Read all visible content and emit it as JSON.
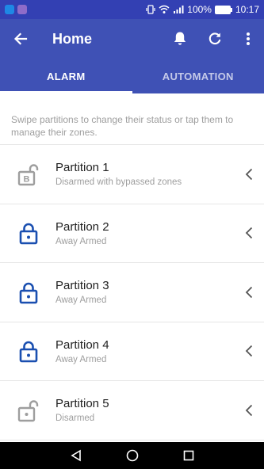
{
  "status_bar": {
    "battery": "100%",
    "time": "10:17"
  },
  "appbar": {
    "title": "Home",
    "icons": [
      "arrow-back-icon",
      "bell-icon",
      "refresh-icon",
      "more-vert-icon"
    ]
  },
  "tabs": [
    {
      "label": "ALARM",
      "active": true
    },
    {
      "label": "AUTOMATION",
      "active": false
    }
  ],
  "hint": "Swipe partitions to change their status or tap them to manage their zones.",
  "partitions": [
    {
      "name": "Partition 1",
      "status": "Disarmed with bypassed zones",
      "icon": "lock-open-bypass-icon"
    },
    {
      "name": "Partition 2",
      "status": "Away Armed",
      "icon": "lock-closed-icon"
    },
    {
      "name": "Partition 3",
      "status": "Away Armed",
      "icon": "lock-closed-icon"
    },
    {
      "name": "Partition 4",
      "status": "Away Armed",
      "icon": "lock-closed-icon"
    },
    {
      "name": "Partition 5",
      "status": "Disarmed",
      "icon": "lock-open-icon"
    }
  ],
  "colors": {
    "primary": "#3f51b5",
    "status_bar": "#3340b3",
    "armed_icon": "#1a4fb0",
    "disarmed_icon": "#9e9e9e"
  }
}
